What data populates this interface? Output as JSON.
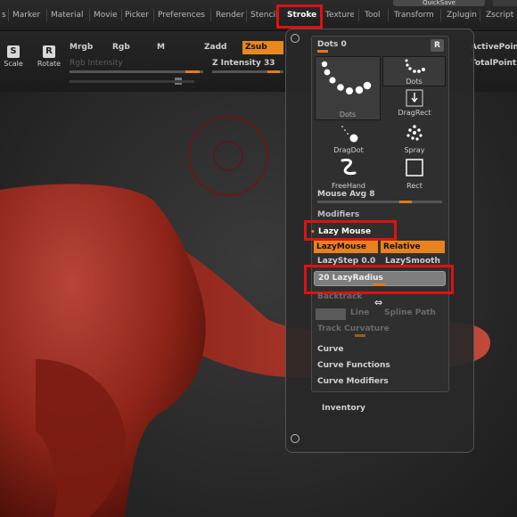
{
  "menu": {
    "items": [
      "s",
      "Marker",
      "Material",
      "Movie",
      "Picker",
      "Preferences",
      "Render",
      "Stencil",
      "Stroke",
      "Texture",
      "Tool",
      "Transform",
      "Zplugin",
      "Zscript"
    ],
    "quicksave": "QuickSave"
  },
  "toolbar": {
    "scale": "Scale",
    "rotate": "Rotate",
    "mrgb": "Mrgb",
    "rgb": "Rgb",
    "m": "M",
    "zadd": "Zadd",
    "zsub": "Zsub",
    "rgb_intensity": "Rgb Intensity",
    "z_intensity": "Z Intensity 33",
    "active_points": "ActivePoin",
    "total_points": "TotalPoint"
  },
  "stroke_panel": {
    "dots_label": "Dots",
    "dots_value": "0",
    "r_button": "R",
    "dots_big_label": "Dots",
    "dots_small_label": "Dots",
    "dragrect_label": "DragRect",
    "dragdot_label": "DragDot",
    "spray_label": "Spray",
    "freehand_label": "FreeHand",
    "rect_label": "Rect",
    "mouse_avg": "Mouse Avg 8",
    "modifiers": "Modifiers",
    "lazy_mouse": "Lazy Mouse",
    "lazymouse_btn": "LazyMouse",
    "relative_btn": "Relative",
    "lazystep": "LazyStep 0.0",
    "lazysmooth": "LazySmooth",
    "lazyradius": "20 LazyRadius",
    "backtrack": "Backtrack",
    "line": "Line",
    "spline_path": "Spline Path",
    "track_curvature": "Track Curvature",
    "curve": "Curve",
    "curve_functions": "Curve Functions",
    "curve_modifiers": "Curve Modifiers",
    "inventory": "Inventory"
  },
  "colors": {
    "accent_orange": "#e8821e",
    "highlight_red": "#e01010",
    "model_red": "#8e2418"
  }
}
